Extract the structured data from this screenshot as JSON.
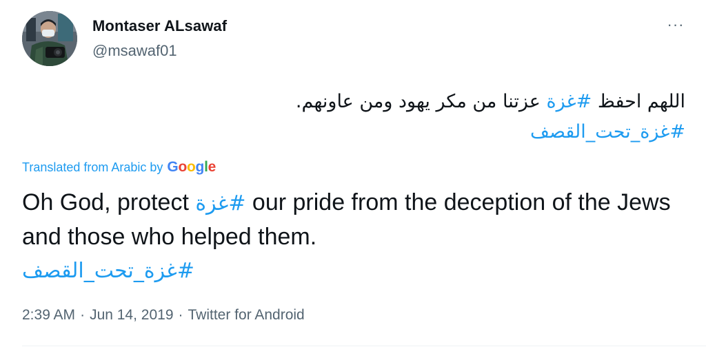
{
  "author": {
    "display_name": "Montaser ALsawaf",
    "handle": "@msawaf01"
  },
  "menu": {
    "more_icon": "more-horizontal-icon",
    "more_label": "···"
  },
  "tweet": {
    "original_prefix": "اللهم احفظ ",
    "original_hashtag_1": "#غزة",
    "original_middle": " عزتنا من مكر يهود ومن عاونهم.",
    "original_hashtag_2": "#غزة_تحت_القصف"
  },
  "translation": {
    "label": "Translated from Arabic by",
    "provider_letters": [
      "G",
      "o",
      "o",
      "g",
      "l",
      "e"
    ],
    "text_before": "Oh God, protect ",
    "hashtag_1": "#غزة",
    "text_after": " our pride from the deception of the Jews and those who helped them.",
    "hashtag_2": "#غزة_تحت_القصف"
  },
  "meta": {
    "time": "2:39 AM",
    "separator": "·",
    "date": "Jun 14, 2019",
    "source": "Twitter for Android"
  },
  "colors": {
    "hashtag": "#1d9bf0",
    "secondary_text": "#536471",
    "primary_text": "#0f1419"
  }
}
